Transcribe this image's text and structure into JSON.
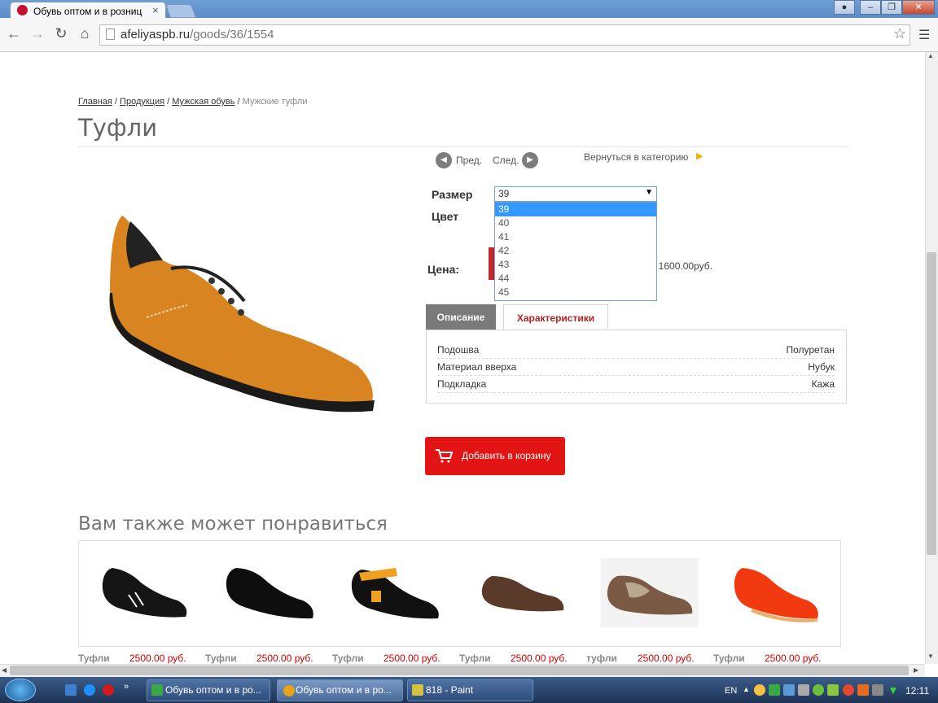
{
  "browser": {
    "tab_title": "Обувь оптом и в розниц",
    "url_host": "afeliyaspb.ru",
    "url_path": "/goods/36/1554"
  },
  "page": {
    "breadcrumb": [
      "Главная",
      "Продукция",
      "Мужская обувь",
      "Мужские туфли"
    ],
    "title": "Туфли",
    "nav": {
      "prev": "Пред.",
      "next": "След.",
      "back": "Вернуться в категорию"
    },
    "size_label": "Размер",
    "color_label": "Цвет",
    "price_label": "Цена:",
    "price_text": ": 1600.00руб.",
    "size_selected": "39",
    "size_options": [
      "39",
      "40",
      "41",
      "42",
      "43",
      "44",
      "45"
    ],
    "tabs": {
      "description": "Описание",
      "characteristics": "Характеристики"
    },
    "characteristics": [
      {
        "key": "Подошва",
        "value": "Полуретан"
      },
      {
        "key": "Материал вверха",
        "value": "Нубук"
      },
      {
        "key": "Подкладка",
        "value": "Кажа"
      }
    ],
    "add_to_cart": "Добавить в корзину",
    "recommend_title": "Вам также может понравиться",
    "recommendations": [
      {
        "name": "Туфли",
        "price": "2500.00 руб."
      },
      {
        "name": "Туфли",
        "price": "2500.00 руб."
      },
      {
        "name": "Туфли",
        "price": "2500.00 руб."
      },
      {
        "name": "Туфли",
        "price": "2500.00 руб."
      },
      {
        "name": "туфли",
        "price": "2500.00 руб."
      },
      {
        "name": "Туфли",
        "price": "2500.00 руб."
      }
    ]
  },
  "taskbar": {
    "items": [
      "Обувь оптом и в ро...",
      "Обувь оптом и в ро...",
      "818 - Paint"
    ],
    "lang": "EN",
    "clock": "12:11"
  }
}
